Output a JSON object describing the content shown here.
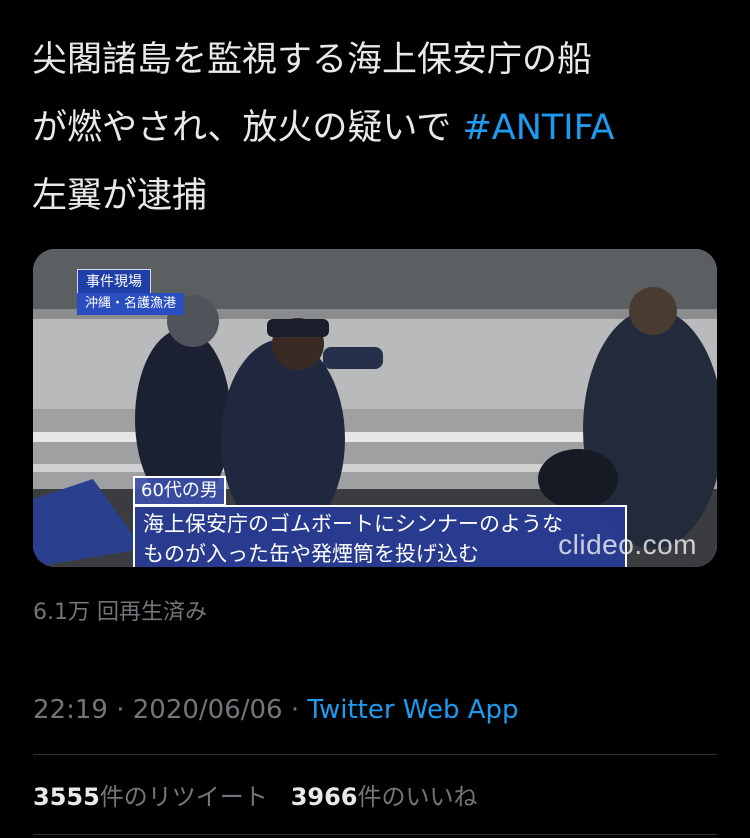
{
  "tweet": {
    "text_line1": "尖閣諸島を監視する海上保安庁の船",
    "text_line2": "が燃やされ、放火の疑いで ",
    "hashtag": "#ANTIFA",
    "text_line3": "左翼が逮捕"
  },
  "video": {
    "chyron_title": "事件現場",
    "chyron_location": "沖縄・名護漁港",
    "caption_tag": "60代の男",
    "caption_line1": "海上保安庁のゴムボートにシンナーのような",
    "caption_line2": "ものが入った缶や発煙筒を投げ込む",
    "watermark": "clideo.com"
  },
  "views": "6.1万 回再生済み",
  "meta": {
    "time": "22:19",
    "separator": " · ",
    "date": "2020/06/06",
    "app": "Twitter Web App"
  },
  "stats": {
    "retweets_count": "3555",
    "retweets_label": "件のリツイート",
    "likes_count": "3966",
    "likes_label": "件のいいね"
  },
  "colors": {
    "background": "#000000",
    "text": "#e7e9ea",
    "muted": "#71767b",
    "link": "#1d9bf0"
  }
}
